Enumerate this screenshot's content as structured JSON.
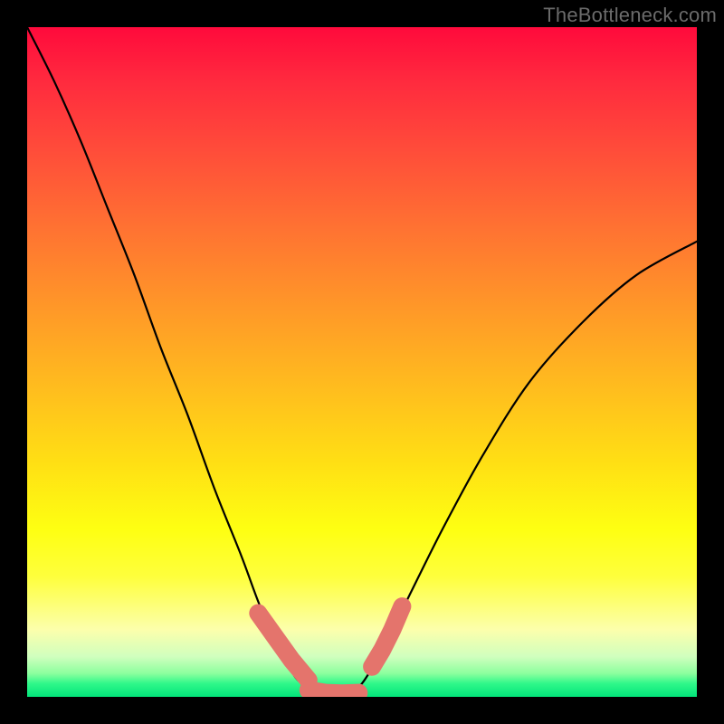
{
  "watermark": "TheBottleneck.com",
  "colors": {
    "page_bg": "#000000",
    "curve": "#000000",
    "marker": "#E4746C",
    "gradient_stops": [
      "#FF0A3C",
      "#FF2A3E",
      "#FF4B3A",
      "#FF7232",
      "#FF9828",
      "#FFBD1E",
      "#FFDF14",
      "#FEFF12",
      "#FEFF3C",
      "#FCFFAC",
      "#D0FFBE",
      "#8CFF9E",
      "#30F88A",
      "#02E47A"
    ]
  },
  "chart_data": {
    "type": "line",
    "title": "",
    "xlabel": "",
    "ylabel": "",
    "xlim": [
      0,
      1
    ],
    "ylim": [
      0,
      1
    ],
    "series": [
      {
        "name": "bottleneck-curve",
        "x": [
          0.0,
          0.04,
          0.08,
          0.12,
          0.16,
          0.2,
          0.24,
          0.28,
          0.32,
          0.35,
          0.38,
          0.4,
          0.42,
          0.44,
          0.46,
          0.48,
          0.5,
          0.53,
          0.57,
          0.62,
          0.68,
          0.75,
          0.83,
          0.91,
          1.0
        ],
        "y": [
          1.0,
          0.92,
          0.83,
          0.73,
          0.63,
          0.52,
          0.42,
          0.31,
          0.21,
          0.13,
          0.07,
          0.03,
          0.015,
          0.008,
          0.005,
          0.008,
          0.02,
          0.07,
          0.15,
          0.25,
          0.36,
          0.47,
          0.56,
          0.63,
          0.68
        ]
      }
    ],
    "markers": {
      "name": "highlighted-segments",
      "color": "#E4746C",
      "segments": [
        {
          "x": [
            0.345,
            0.37,
            0.395,
            0.42
          ],
          "y": [
            0.125,
            0.09,
            0.055,
            0.025
          ]
        },
        {
          "x": [
            0.42,
            0.445,
            0.47,
            0.495
          ],
          "y": [
            0.01,
            0.006,
            0.005,
            0.006
          ]
        },
        {
          "x": [
            0.515,
            0.53,
            0.545,
            0.56
          ],
          "y": [
            0.045,
            0.07,
            0.1,
            0.135
          ]
        }
      ]
    }
  }
}
